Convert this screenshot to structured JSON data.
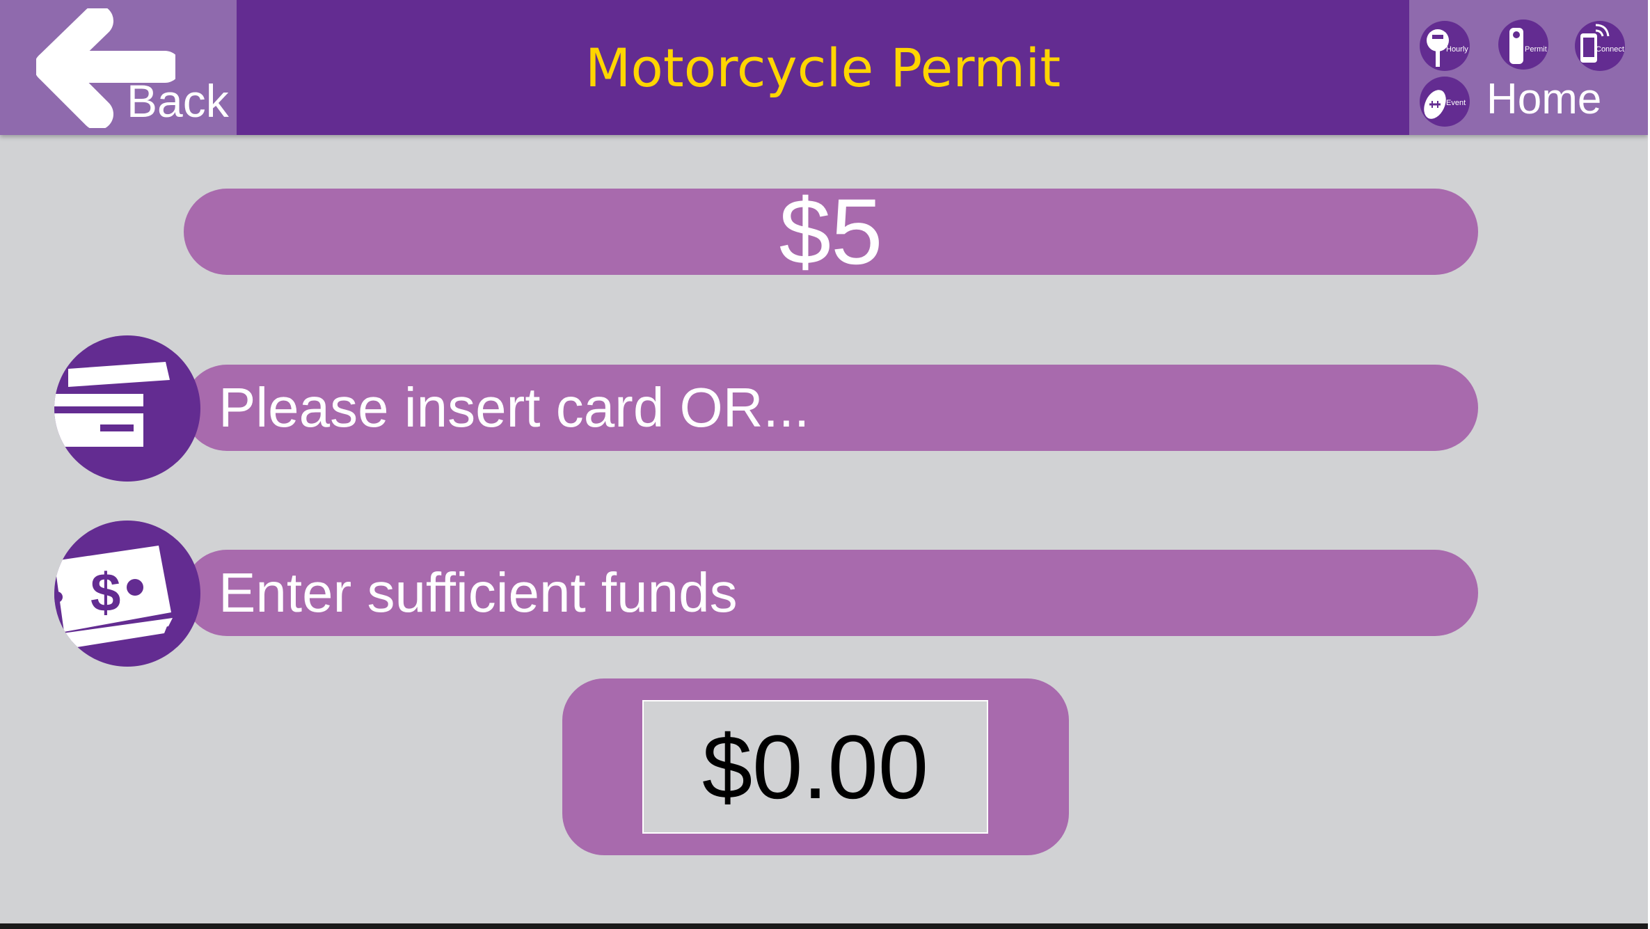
{
  "header": {
    "back_label": "Back",
    "title": "Motorcycle Permit",
    "home_label": "Home",
    "nav_icons": [
      {
        "label": "Hourly",
        "icon": "parking-meter-icon"
      },
      {
        "label": "Permit",
        "icon": "hang-tag-icon"
      },
      {
        "label": "Connect",
        "icon": "mobile-phone-icon"
      },
      {
        "label": "Event",
        "icon": "football-icon"
      }
    ]
  },
  "main": {
    "price": "$5",
    "card_prompt": "Please insert card OR...",
    "cash_prompt": "Enter sufficient funds",
    "amount_entered": "$0.00"
  },
  "colors": {
    "header_purple": "#632c91",
    "panel_purple": "#8f6aad",
    "pill_purple": "#a86aad",
    "title_yellow": "#ffd500",
    "background_gray": "#d1d2d4"
  }
}
